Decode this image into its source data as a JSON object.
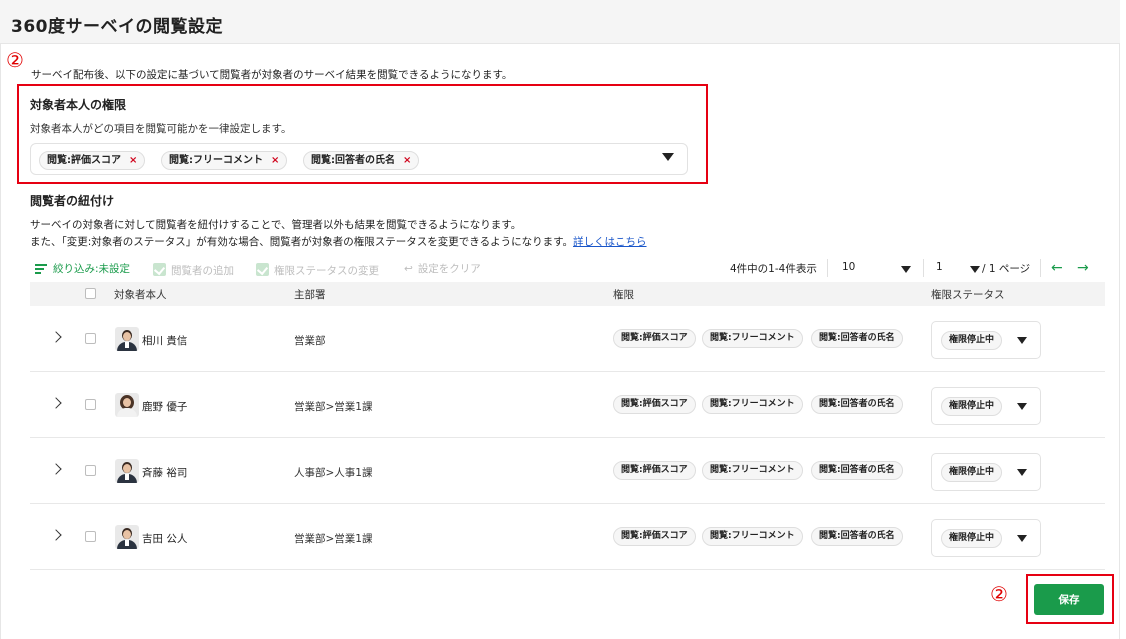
{
  "page_title": "360度サーベイの閲覧設定",
  "annotation_marker": "②",
  "intro_text": "サーベイ配布後、以下の設定に基づいて閲覧者が対象者のサーベイ結果を閲覧できるようになります。",
  "self_permission": {
    "title": "対象者本人の権限",
    "description": "対象者本人がどの項目を閲覧可能かを一律設定します。",
    "selected_items": [
      "閲覧:評価スコア",
      "閲覧:フリーコメント",
      "閲覧:回答者の氏名"
    ],
    "remove_glyph": "×"
  },
  "viewer_link": {
    "title": "閲覧者の紐付け",
    "description_line1": "サーベイの対象者に対して閲覧者を紐付けすることで、管理者以外も結果を閲覧できるようになります。",
    "description_line2": "また、「変更:対象者のステータス」が有効な場合、閲覧者が対象者の権限ステータスを変更できるようになります。",
    "more_link": "詳しくはこちら"
  },
  "toolbar": {
    "filter": "絞り込み:未設定",
    "add_viewer": "閲覧者の追加",
    "change_status": "権限ステータスの変更",
    "clear_settings": "設定をクリア",
    "result_count": "4件中の1-4件表示",
    "per_page": "10",
    "current_page": "1",
    "total_pages": "/ 1 ページ",
    "prev_arrow": "←",
    "next_arrow": "→"
  },
  "table": {
    "headers": {
      "target": "対象者本人",
      "department": "主部署",
      "permission": "権限",
      "status": "権限ステータス"
    },
    "rows": [
      {
        "name": "相川 貴信",
        "dept": "営業部",
        "permissions": [
          "閲覧:評価スコア",
          "閲覧:フリーコメント",
          "閲覧:回答者の氏名"
        ],
        "status": "権限停止中"
      },
      {
        "name": "鹿野 優子",
        "dept": "営業部>営業1課",
        "permissions": [
          "閲覧:評価スコア",
          "閲覧:フリーコメント",
          "閲覧:回答者の氏名"
        ],
        "status": "権限停止中"
      },
      {
        "name": "斉藤 裕司",
        "dept": "人事部>人事1課",
        "permissions": [
          "閲覧:評価スコア",
          "閲覧:フリーコメント",
          "閲覧:回答者の氏名"
        ],
        "status": "権限停止中"
      },
      {
        "name": "吉田 公人",
        "dept": "営業部>営業1課",
        "permissions": [
          "閲覧:評価スコア",
          "閲覧:フリーコメント",
          "閲覧:回答者の氏名"
        ],
        "status": "権限停止中"
      }
    ]
  },
  "save_button": "保存",
  "colors": {
    "accent_green": "#1a9b4b",
    "annotation_red": "#e60012",
    "link_blue": "#1a56c9"
  }
}
